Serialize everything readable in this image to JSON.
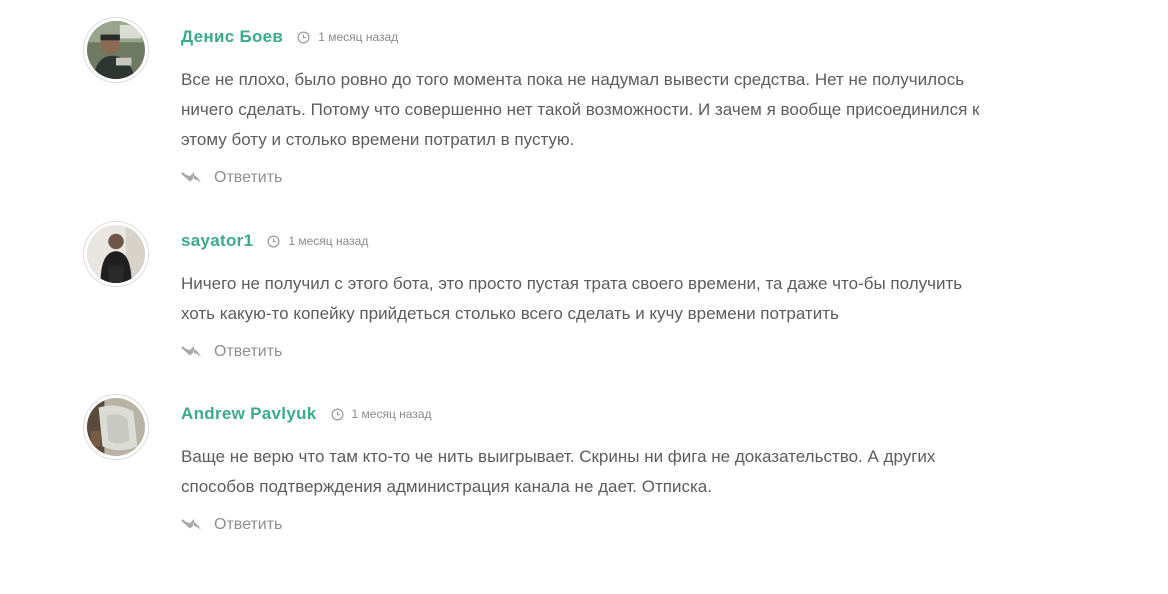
{
  "comments": [
    {
      "author": "Денис Боев",
      "time": "1 месяц назад",
      "text_lines": [
        "Все не плохо, было ровно до того момента пока не надумал вывести средства. Нет не получилось",
        "ничего сделать. Потому что совершенно нет такой возможности. И зачем я вообще присоединился к",
        "этому боту и столько времени потратил в пустую."
      ],
      "reply_label": "Ответить"
    },
    {
      "author": "sayator1",
      "time": "1 месяц назад",
      "text_lines": [
        "Ничего не получил с этого бота, это просто пустая трата своего времени, та даже что-бы получить",
        "хоть какую-то копейку прийдеться столько всего сделать и кучу времени потратить"
      ],
      "reply_label": "Ответить"
    },
    {
      "author": "Andrew Pavlyuk",
      "time": "1 месяц назад",
      "text_lines": [
        "Ваще не верю что там кто-то че нить выигрывает. Скрины ни фига не доказательство. А других",
        "способов подтверждения администрация канала не дает. Отписка."
      ],
      "reply_label": "Ответить"
    }
  ],
  "icons": {
    "clock": "clock-icon",
    "reply": "reply-arrow-icon"
  },
  "colors": {
    "author": "#3aab8c",
    "text": "#5c5c5c",
    "muted": "#8a8a8a"
  }
}
